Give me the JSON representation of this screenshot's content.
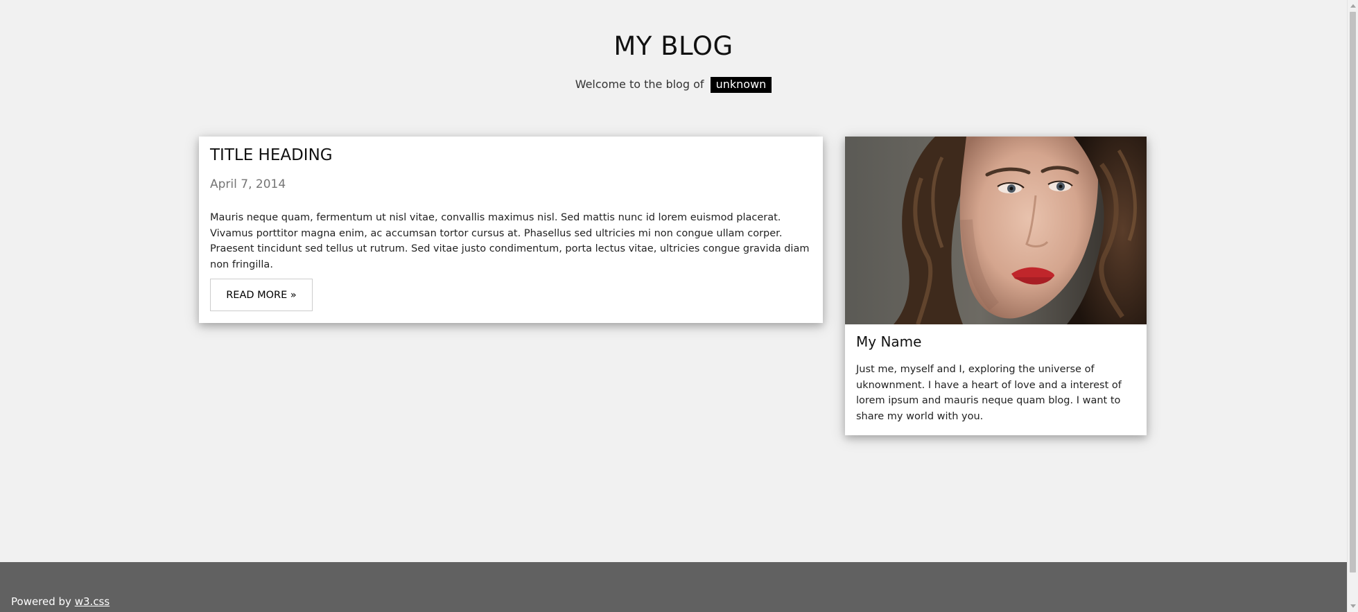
{
  "header": {
    "title": "MY BLOG",
    "tagline": "Welcome to the blog of",
    "tag": "unknown"
  },
  "post": {
    "title": "TITLE HEADING",
    "date": "April 7, 2014",
    "body": "Mauris neque quam, fermentum ut nisl vitae, convallis maximus nisl. Sed mattis nunc id lorem euismod placerat. Vivamus porttitor magna enim, ac accumsan tortor cursus at. Phasellus sed ultricies mi non congue ullam corper. Praesent tincidunt sed tellus ut rutrum. Sed vitae justo condimentum, porta lectus vitae, ultricies congue gravida diam non fringilla.",
    "read_more_label": "READ MORE »"
  },
  "profile": {
    "name": "My Name",
    "bio": "Just me, myself and I, exploring the universe of uknownment. I have a heart of love and a interest of lorem ipsum and mauris neque quam blog. I want to share my world with you."
  },
  "footer": {
    "powered_prefix": "Powered by",
    "powered_link": "w3.css"
  },
  "colors": {
    "page_background": "#f1f1f1",
    "card_background": "#ffffff",
    "footer_background": "#616161",
    "tag_background": "#000000",
    "date_text": "#757575"
  }
}
